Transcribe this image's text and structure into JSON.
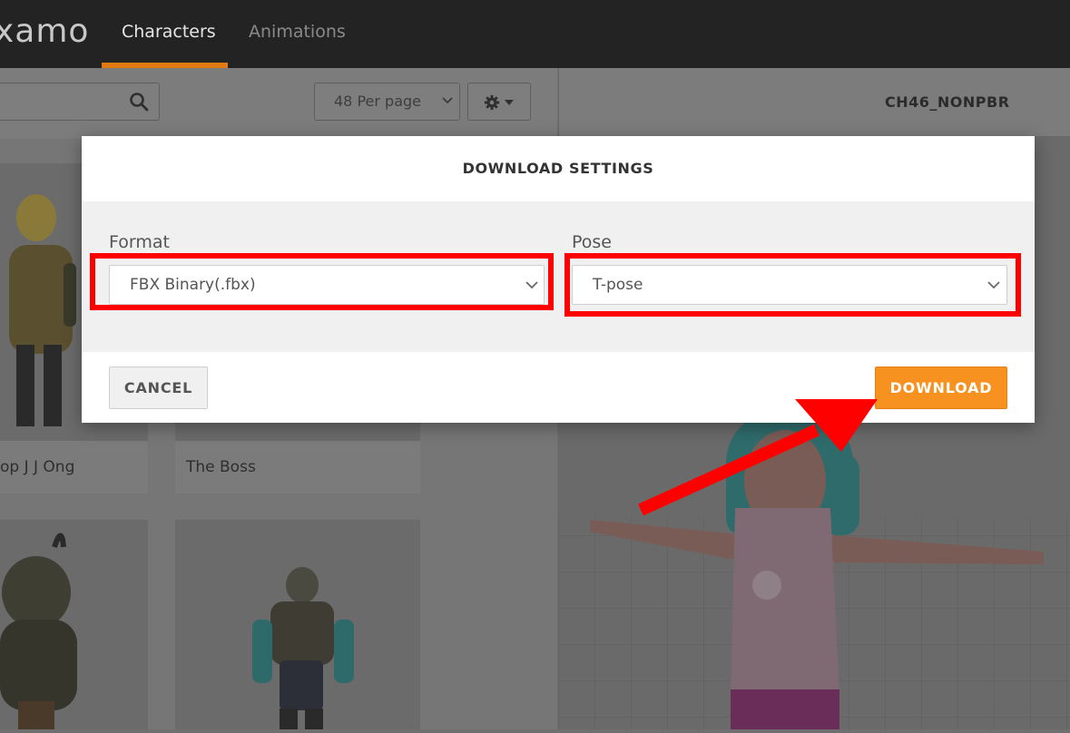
{
  "app": {
    "logo_text": "xamo"
  },
  "nav": {
    "tabs": [
      {
        "label": "Characters",
        "active": true
      },
      {
        "label": "Animations",
        "active": false
      }
    ]
  },
  "toolbar": {
    "per_page_label": "48 Per page"
  },
  "preview": {
    "character_name": "CH46_NONPBR"
  },
  "grid": {
    "cards": [
      {
        "label": "op J J Ong"
      },
      {
        "label": "The Boss"
      }
    ]
  },
  "modal": {
    "title": "DOWNLOAD SETTINGS",
    "format_label": "Format",
    "format_value": "FBX Binary(.fbx)",
    "pose_label": "Pose",
    "pose_value": "T-pose",
    "cancel_label": "CANCEL",
    "download_label": "DOWNLOAD"
  },
  "colors": {
    "accent": "#f7911f",
    "highlight": "#ff0000",
    "nav_underline": "#e07a12"
  }
}
